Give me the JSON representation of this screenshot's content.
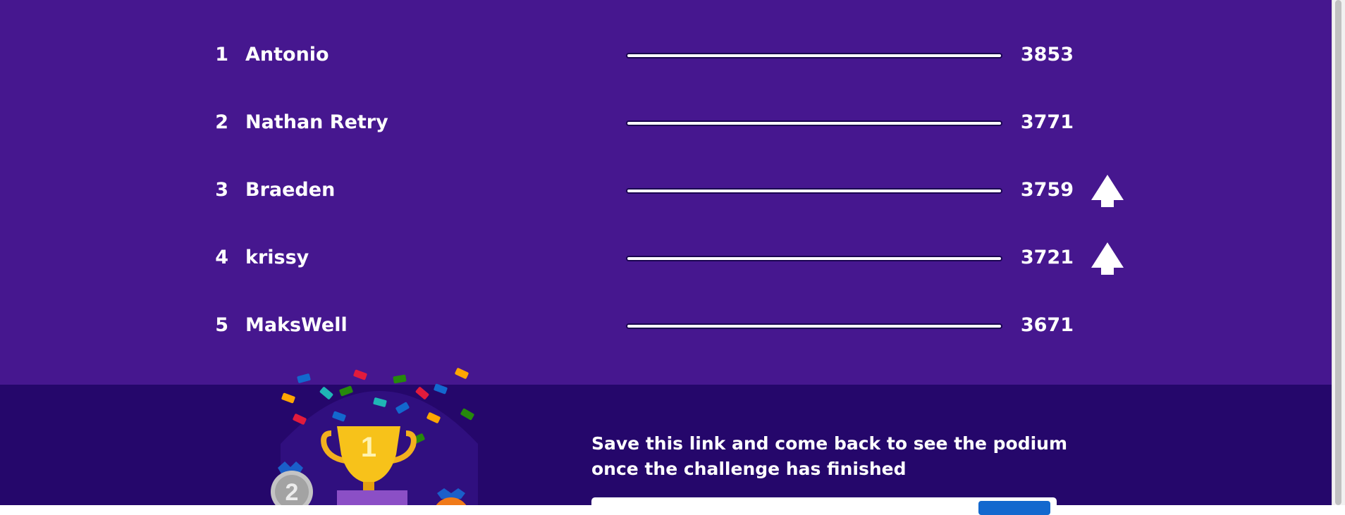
{
  "leaderboard": {
    "rows": [
      {
        "rank": "1",
        "name": "Antonio",
        "score": "3853",
        "moved_up": false
      },
      {
        "rank": "2",
        "name": "Nathan Retry",
        "score": "3771",
        "moved_up": false
      },
      {
        "rank": "3",
        "name": "Braeden",
        "score": "3759",
        "moved_up": true
      },
      {
        "rank": "4",
        "name": "krissy",
        "score": "3721",
        "moved_up": true
      },
      {
        "rank": "5",
        "name": "MaksWell",
        "score": "3671",
        "moved_up": false
      }
    ]
  },
  "footer": {
    "message_line1": "Save this link and come back to see the podium",
    "message_line2": "once the challenge has finished",
    "podium_gold": "1",
    "podium_silver": "2"
  },
  "colors": {
    "top_background": "#46178f",
    "bottom_background": "#25076b",
    "text": "#ffffff",
    "copy_button": "#1368ce"
  }
}
